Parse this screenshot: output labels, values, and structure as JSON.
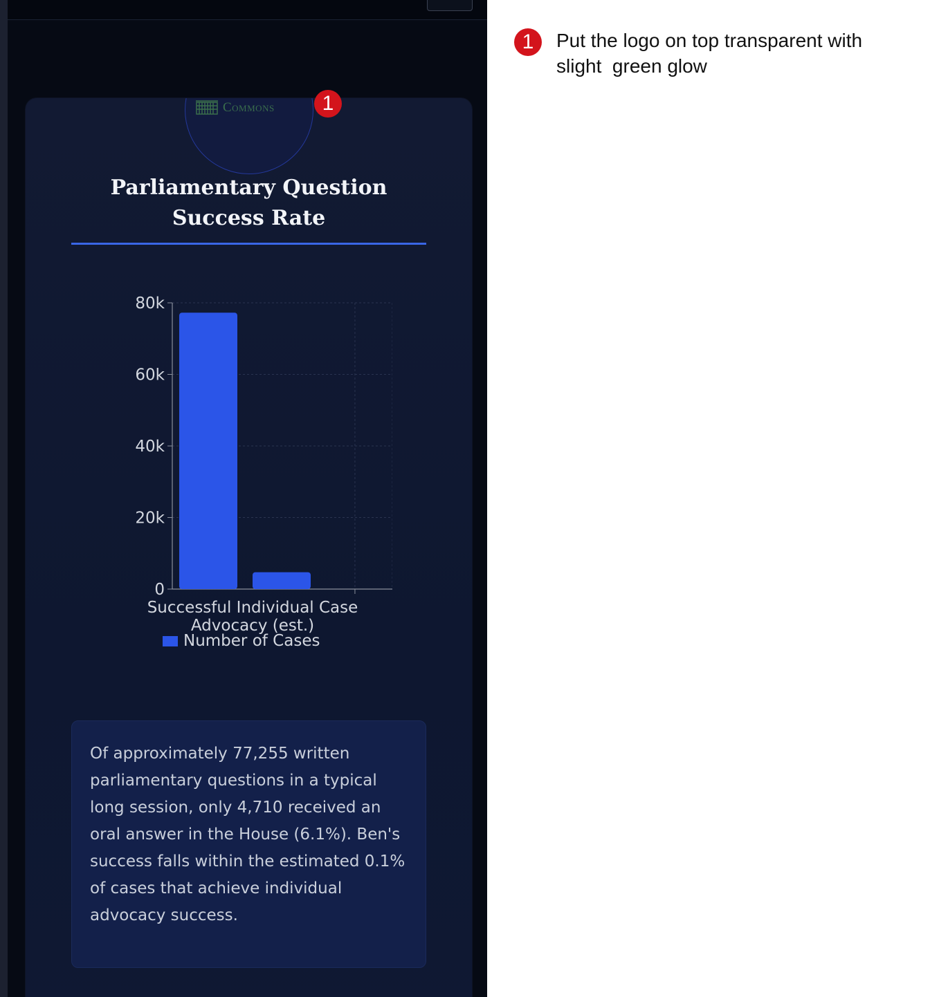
{
  "logo": {
    "text": "Commons",
    "text_color": "#3a6e4c"
  },
  "card": {
    "title": "Parliamentary Question Success Rate",
    "accent_color": "#3a66e6"
  },
  "chart_data": {
    "type": "bar",
    "categories": [
      "Successful Individual Case Advocacy (est.)",
      "Successful Individual Case Advocacy (est.)"
    ],
    "category_label_visible": "Successful Individual Case Advocacy (est.)",
    "series": [
      {
        "name": "Number of Cases",
        "values": [
          77255,
          4710
        ],
        "color": "#2b55e8"
      }
    ],
    "yticks": [
      "0",
      "20k",
      "40k",
      "60k",
      "80k"
    ],
    "ylim": [
      0,
      80000
    ],
    "grid": true,
    "legend_placement": "bottom"
  },
  "note": {
    "text": "Of approximately 77,255 written parliamentary questions in a typical long session, only 4,710 received an oral answer in the House (6.1%). Ben's success falls within the estimated 0.1% of cases that achieve individual advocacy success."
  },
  "annotation": {
    "number": "1",
    "comment": "Put the logo on top transparent with slight  green glow",
    "color": "#d3141c"
  }
}
